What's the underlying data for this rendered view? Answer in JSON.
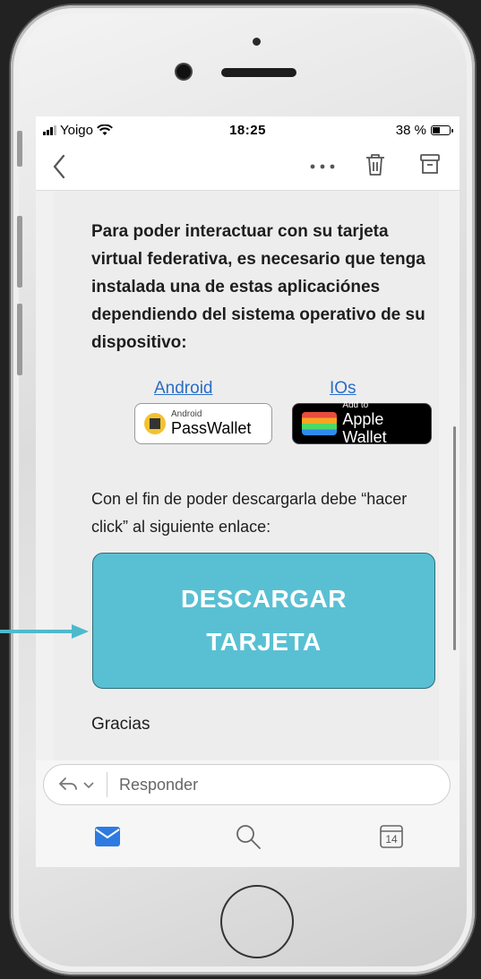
{
  "status_bar": {
    "carrier": "Yoigo",
    "time": "18:25",
    "battery_text": "38 %",
    "battery_level": 0.38
  },
  "nav": {
    "back_icon": "chevron-left-icon",
    "more_icon": "more-dots-icon",
    "trash_icon": "trash-icon",
    "archive_icon": "archive-icon"
  },
  "mail": {
    "intro": "Para poder interactuar con su tarjeta virtual federativa, es necesario que tenga instalada una de estas aplicaciónes dependiendo del sistema operativo de su dispositivo:",
    "android_link": "Android",
    "ios_link": "IOs",
    "passwallet_small": "Android",
    "passwallet_big": "PassWallet",
    "applewallet_small": "Add to",
    "applewallet_big": "Apple Wallet",
    "instructions": "Con el fin de poder descargarla debe “hacer click” al siguiente enlace:",
    "download_button": "DESCARGAR TARJETA",
    "thanks": "Gracias"
  },
  "reply": {
    "placeholder": "Responder",
    "calendar_day": "14"
  },
  "colors": {
    "button": "#59c0d3",
    "arrow": "#4fb9cc",
    "link": "#2a6dc6",
    "tab_active": "#2d7be0"
  }
}
